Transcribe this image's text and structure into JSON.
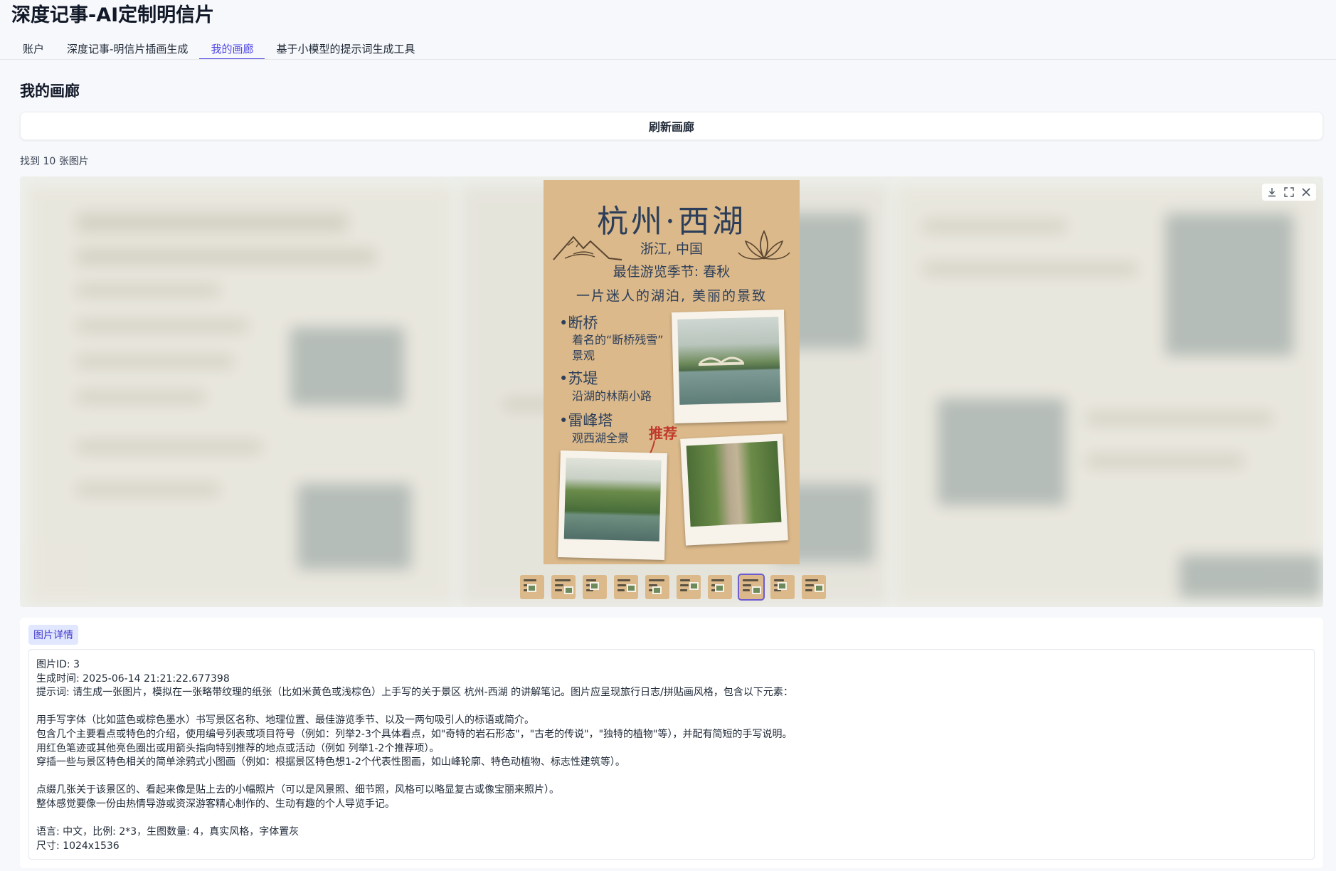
{
  "app": {
    "title": "深度记事-AI定制明信片"
  },
  "tabs": [
    {
      "label": "账户"
    },
    {
      "label": "深度记事-明信片插画生成"
    },
    {
      "label": "我的画廊"
    },
    {
      "label": "基于小模型的提示词生成工具"
    }
  ],
  "gallery": {
    "title": "我的画廊",
    "refresh_label": "刷新画廊",
    "found_text": "找到 10 张图片",
    "controls": {
      "download_icon": "download-icon",
      "fullscreen_icon": "fullscreen-icon",
      "close_icon": "close-icon"
    },
    "postcard": {
      "title": "杭州·西湖",
      "location": "浙江, 中国",
      "season": "最佳游览季节: 春秋",
      "slogan": "一片迷人的湖泊, 美丽的景致",
      "items": [
        {
          "name": "•断桥",
          "desc": "着名的“断桥残雪”\n景观"
        },
        {
          "name": "•苏堤",
          "desc": "沿湖的林荫小路"
        },
        {
          "name": "•雷峰塔",
          "desc": "观西湖全景"
        }
      ],
      "recommend": "推荐"
    },
    "thumbnail_count": 10,
    "selected_thumbnail": 8
  },
  "details": {
    "tag": "图片详情",
    "text": "图片ID: 3\n生成时间: 2025-06-14 21:21:22.677398\n提示词: 请生成一张图片，模拟在一张略带纹理的纸张（比如米黄色或浅棕色）上手写的关于景区 杭州-西湖 的讲解笔记。图片应呈现旅行日志/拼贴画风格，包含以下元素：\n\n用手写字体（比如蓝色或棕色墨水）书写景区名称、地理位置、最佳游览季节、以及一两句吸引人的标语或简介。\n包含几个主要看点或特色的介绍，使用编号列表或项目符号（例如：列举2-3个具体看点，如\"奇特的岩石形态\"，\"古老的传说\"，\"独特的植物\"等），并配有简短的手写说明。\n用红色笔迹或其他亮色圈出或用箭头指向特别推荐的地点或活动（例如 列举1-2个推荐项）。\n穿插一些与景区特色相关的简单涂鸦式小图画（例如：根据景区特色想1-2个代表性图画，如山峰轮廓、特色动植物、标志性建筑等）。\n\n点缀几张关于该景区的、看起来像是贴上去的小幅照片（可以是风景照、细节照，风格可以略显复古或像宝丽来照片）。\n整体感觉要像一份由热情导游或资深游客精心制作的、生动有趣的个人导览手记。\n\n语言: 中文，比例: 2*3，生图数量: 4，真实风格，字体置灰\n尺寸: 1024x1536"
  },
  "colors": {
    "accent": "#4f46e5",
    "paper": "#dbb98a",
    "ink": "#2c3e5a",
    "recommend_red": "#c0392b"
  }
}
